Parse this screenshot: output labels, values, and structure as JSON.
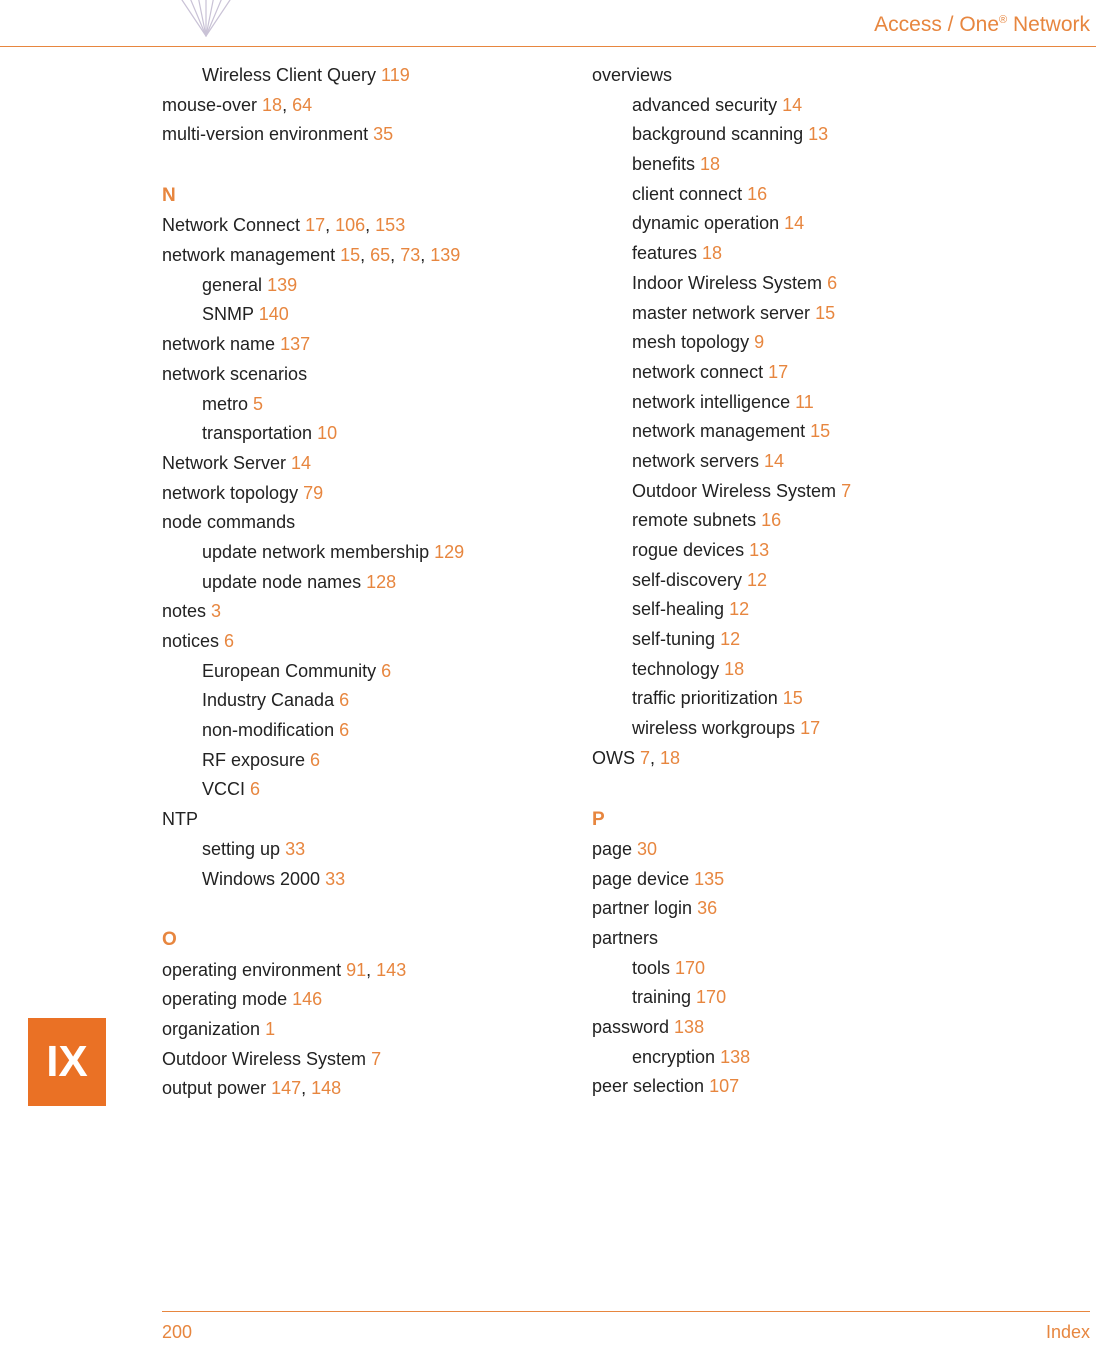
{
  "header": {
    "title_prefix": "Access / One",
    "title_suffix": " Network",
    "reg": "®"
  },
  "side_tab": "IX",
  "footer": {
    "page": "200",
    "label": "Index"
  },
  "col1": [
    {
      "text": "Wireless Client Query",
      "pages": [
        "119"
      ],
      "indent": 1
    },
    {
      "text": "mouse-over",
      "pages": [
        "18",
        "64"
      ],
      "indent": 0
    },
    {
      "text": "multi-version environment",
      "pages": [
        "35"
      ],
      "indent": 0
    },
    {
      "letter": "N"
    },
    {
      "text": "Network Connect",
      "pages": [
        "17",
        "106",
        "153"
      ],
      "indent": 0
    },
    {
      "text": "network management",
      "pages": [
        "15",
        "65",
        "73",
        "139"
      ],
      "indent": 0
    },
    {
      "text": "general",
      "pages": [
        "139"
      ],
      "indent": 1
    },
    {
      "text": "SNMP",
      "pages": [
        "140"
      ],
      "indent": 1
    },
    {
      "text": "network name",
      "pages": [
        "137"
      ],
      "indent": 0
    },
    {
      "text": "network scenarios",
      "pages": [],
      "indent": 0
    },
    {
      "text": "metro",
      "pages": [
        "5"
      ],
      "indent": 1
    },
    {
      "text": "transportation",
      "pages": [
        "10"
      ],
      "indent": 1
    },
    {
      "text": "Network Server",
      "pages": [
        "14"
      ],
      "indent": 0
    },
    {
      "text": "network topology",
      "pages": [
        "79"
      ],
      "indent": 0
    },
    {
      "text": "node commands",
      "pages": [],
      "indent": 0
    },
    {
      "text": "update network membership",
      "pages": [
        "129"
      ],
      "indent": 1
    },
    {
      "text": "update node names",
      "pages": [
        "128"
      ],
      "indent": 1
    },
    {
      "text": "notes",
      "pages": [
        "3"
      ],
      "indent": 0
    },
    {
      "text": "notices",
      "pages": [
        "6"
      ],
      "indent": 0
    },
    {
      "text": "European Community",
      "pages": [
        "6"
      ],
      "indent": 1
    },
    {
      "text": "Industry Canada",
      "pages": [
        "6"
      ],
      "indent": 1
    },
    {
      "text": "non-modification",
      "pages": [
        "6"
      ],
      "indent": 1
    },
    {
      "text": "RF exposure",
      "pages": [
        "6"
      ],
      "indent": 1
    },
    {
      "text": "VCCI",
      "pages": [
        "6"
      ],
      "indent": 1
    },
    {
      "text": "NTP",
      "pages": [],
      "indent": 0
    },
    {
      "text": "setting up",
      "pages": [
        "33"
      ],
      "indent": 1
    },
    {
      "text": "Windows 2000",
      "pages": [
        "33"
      ],
      "indent": 1
    },
    {
      "letter": "O"
    },
    {
      "text": "operating environment",
      "pages": [
        "91",
        "143"
      ],
      "indent": 0
    },
    {
      "text": "operating mode",
      "pages": [
        "146"
      ],
      "indent": 0
    },
    {
      "text": "organization",
      "pages": [
        "1"
      ],
      "indent": 0
    },
    {
      "text": "Outdoor Wireless System",
      "pages": [
        "7"
      ],
      "indent": 0
    },
    {
      "text": "output power",
      "pages": [
        "147",
        "148"
      ],
      "indent": 0
    }
  ],
  "col2": [
    {
      "text": "overviews",
      "pages": [],
      "indent": 0
    },
    {
      "text": "advanced security",
      "pages": [
        "14"
      ],
      "indent": 1
    },
    {
      "text": "background scanning",
      "pages": [
        "13"
      ],
      "indent": 1
    },
    {
      "text": "benefits",
      "pages": [
        "18"
      ],
      "indent": 1
    },
    {
      "text": "client connect",
      "pages": [
        "16"
      ],
      "indent": 1
    },
    {
      "text": "dynamic operation",
      "pages": [
        "14"
      ],
      "indent": 1
    },
    {
      "text": "features",
      "pages": [
        "18"
      ],
      "indent": 1
    },
    {
      "text": "Indoor Wireless System",
      "pages": [
        "6"
      ],
      "indent": 1
    },
    {
      "text": "master network server",
      "pages": [
        "15"
      ],
      "indent": 1
    },
    {
      "text": "mesh topology",
      "pages": [
        "9"
      ],
      "indent": 1
    },
    {
      "text": "network connect",
      "pages": [
        "17"
      ],
      "indent": 1
    },
    {
      "text": "network intelligence",
      "pages": [
        "11"
      ],
      "indent": 1
    },
    {
      "text": "network management",
      "pages": [
        "15"
      ],
      "indent": 1
    },
    {
      "text": "network servers",
      "pages": [
        "14"
      ],
      "indent": 1
    },
    {
      "text": "Outdoor Wireless System",
      "pages": [
        "7"
      ],
      "indent": 1
    },
    {
      "text": "remote subnets",
      "pages": [
        "16"
      ],
      "indent": 1
    },
    {
      "text": "rogue devices",
      "pages": [
        "13"
      ],
      "indent": 1
    },
    {
      "text": "self-discovery",
      "pages": [
        "12"
      ],
      "indent": 1
    },
    {
      "text": "self-healing",
      "pages": [
        "12"
      ],
      "indent": 1
    },
    {
      "text": "self-tuning",
      "pages": [
        "12"
      ],
      "indent": 1
    },
    {
      "text": "technology",
      "pages": [
        "18"
      ],
      "indent": 1
    },
    {
      "text": "traffic prioritization",
      "pages": [
        "15"
      ],
      "indent": 1
    },
    {
      "text": "wireless workgroups",
      "pages": [
        "17"
      ],
      "indent": 1
    },
    {
      "text": "OWS",
      "pages": [
        "7",
        "18"
      ],
      "indent": 0
    },
    {
      "letter": "P"
    },
    {
      "text": "page",
      "pages": [
        "30"
      ],
      "indent": 0
    },
    {
      "text": "page device",
      "pages": [
        "135"
      ],
      "indent": 0
    },
    {
      "text": "partner login",
      "pages": [
        "36"
      ],
      "indent": 0
    },
    {
      "text": "partners",
      "pages": [],
      "indent": 0
    },
    {
      "text": "tools",
      "pages": [
        "170"
      ],
      "indent": 1
    },
    {
      "text": "training",
      "pages": [
        "170"
      ],
      "indent": 1
    },
    {
      "text": "password",
      "pages": [
        "138"
      ],
      "indent": 0
    },
    {
      "text": "encryption",
      "pages": [
        "138"
      ],
      "indent": 1
    },
    {
      "text": "peer selection",
      "pages": [
        "107"
      ],
      "indent": 0
    }
  ]
}
